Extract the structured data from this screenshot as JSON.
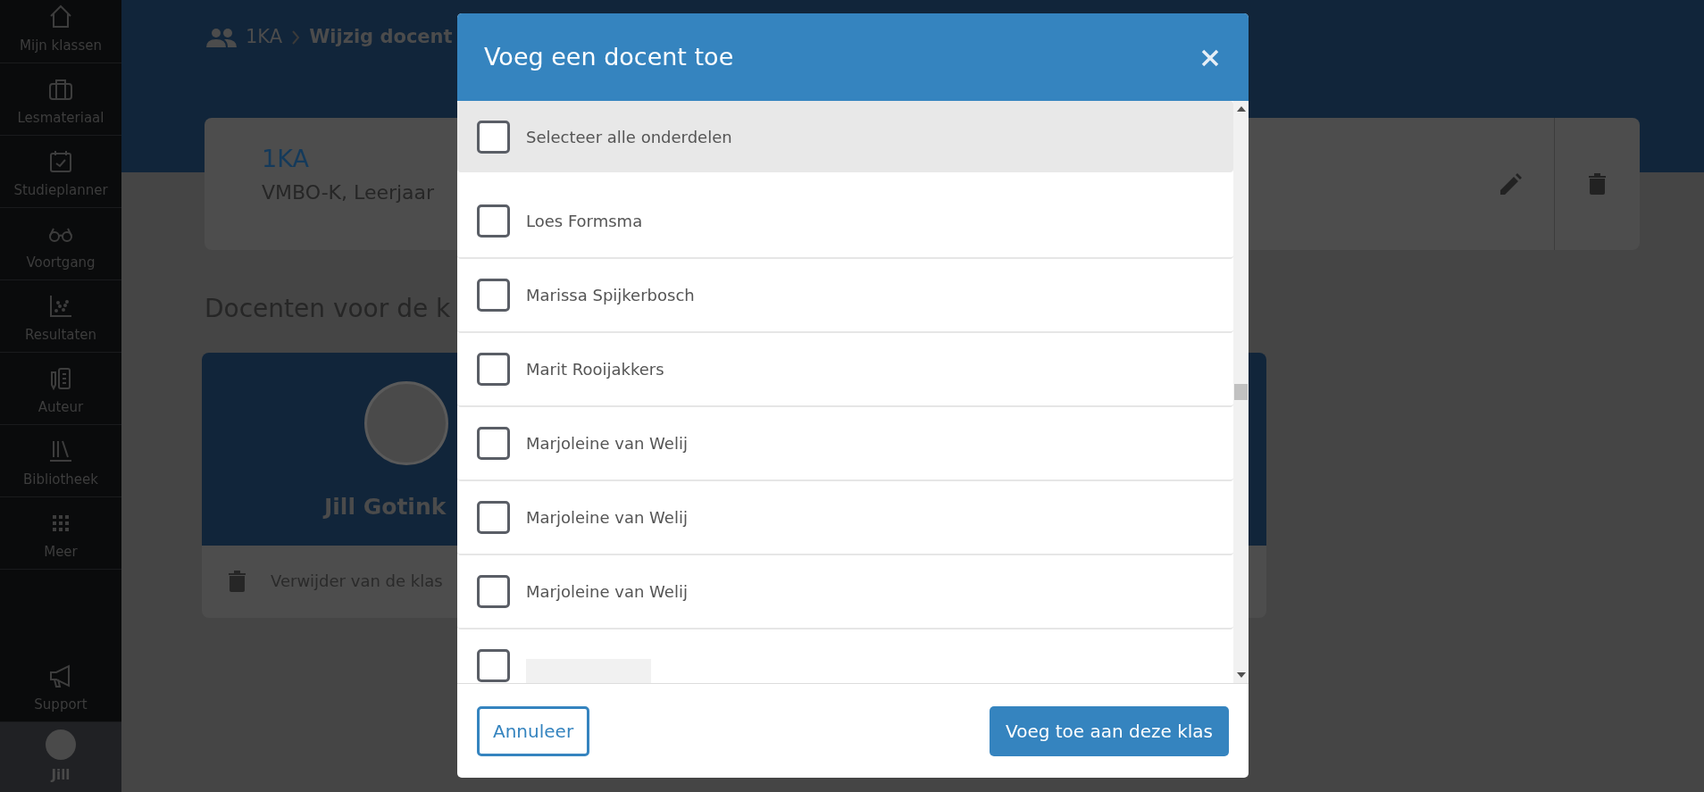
{
  "sidebar": {
    "items": [
      {
        "label": "Mijn klassen"
      },
      {
        "label": "Lesmateriaal"
      },
      {
        "label": "Studieplanner"
      },
      {
        "label": "Voortgang"
      },
      {
        "label": "Resultaten"
      },
      {
        "label": "Auteur"
      },
      {
        "label": "Bibliotheek"
      },
      {
        "label": "Meer"
      }
    ],
    "support": {
      "label": "Support"
    },
    "user": {
      "label": "Jill"
    }
  },
  "breadcrumb": [
    "1KA",
    "Wijzig docent"
  ],
  "class_card": {
    "title": "1KA",
    "subtitle": "VMBO-K, Leerjaar"
  },
  "section_title": "Docenten voor de k",
  "teacher_card": {
    "name": "Jill Gotink",
    "action": "Verwijder van de klas"
  },
  "dialog": {
    "title": "Voeg een docent toe",
    "select_all": {
      "label": "Selecteer alle onderdelen",
      "checked": false
    },
    "teachers": [
      {
        "name": "Loes Formsma",
        "checked": false
      },
      {
        "name": "Marissa Spijkerbosch",
        "checked": false
      },
      {
        "name": "Marit Rooijakkers",
        "checked": false
      },
      {
        "name": "Marjoleine van Welij",
        "checked": false
      },
      {
        "name": "Marjoleine van Welij",
        "checked": false
      },
      {
        "name": "Marjoleine van Welij",
        "checked": false
      },
      {
        "checked": false
      }
    ],
    "cancel": "Annuleer",
    "confirm": "Voeg toe aan deze klas"
  }
}
